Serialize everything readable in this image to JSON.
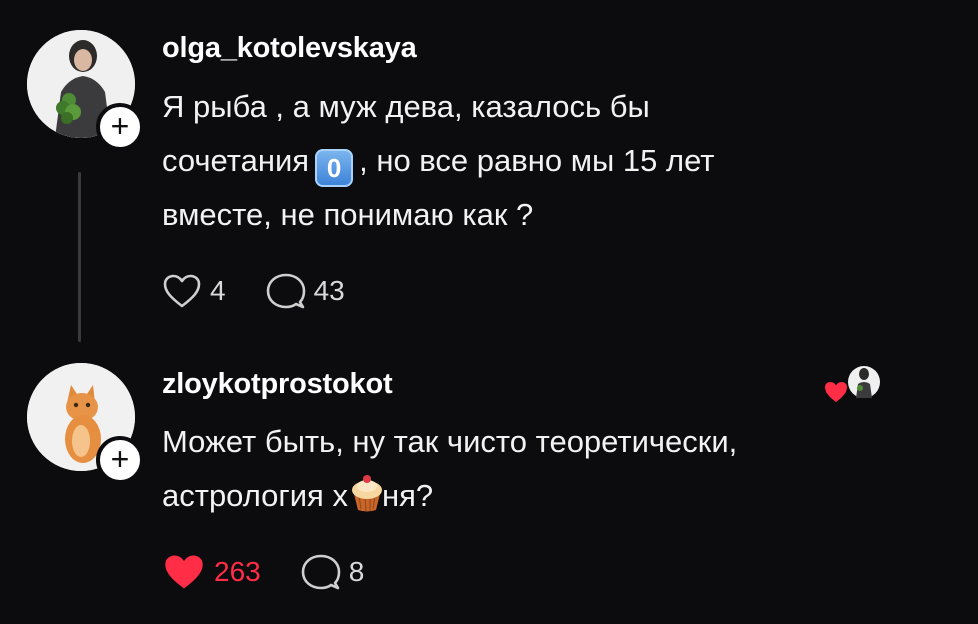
{
  "posts": [
    {
      "username": "olga_kotolevskaya",
      "text_line1": "Я рыба , а муж дева, казалось бы",
      "text_line2_pre": "сочетания",
      "text_line2_emoji": "0",
      "text_line2_post": ", но все равно мы 15 лет",
      "text_line3": "вместе, не понимаю как ?",
      "likes": "4",
      "comments": "43",
      "follow_label": "+"
    },
    {
      "username": "zloykotprostokot",
      "text_line1": "Может быть, ну так чисто теоретически,",
      "text_line2_pre": "астрология х",
      "text_line2_post": "ня?",
      "likes": "263",
      "comments": "8",
      "follow_label": "+"
    }
  ],
  "icons": {
    "like": "heart-icon",
    "comment": "comment-bubble-icon",
    "follow": "plus-icon",
    "author_liked": "author-liked-heart-icon"
  },
  "colors": {
    "background": "#0c0b0d",
    "liked": "#ff2d46",
    "text": "#f2f2f2"
  }
}
